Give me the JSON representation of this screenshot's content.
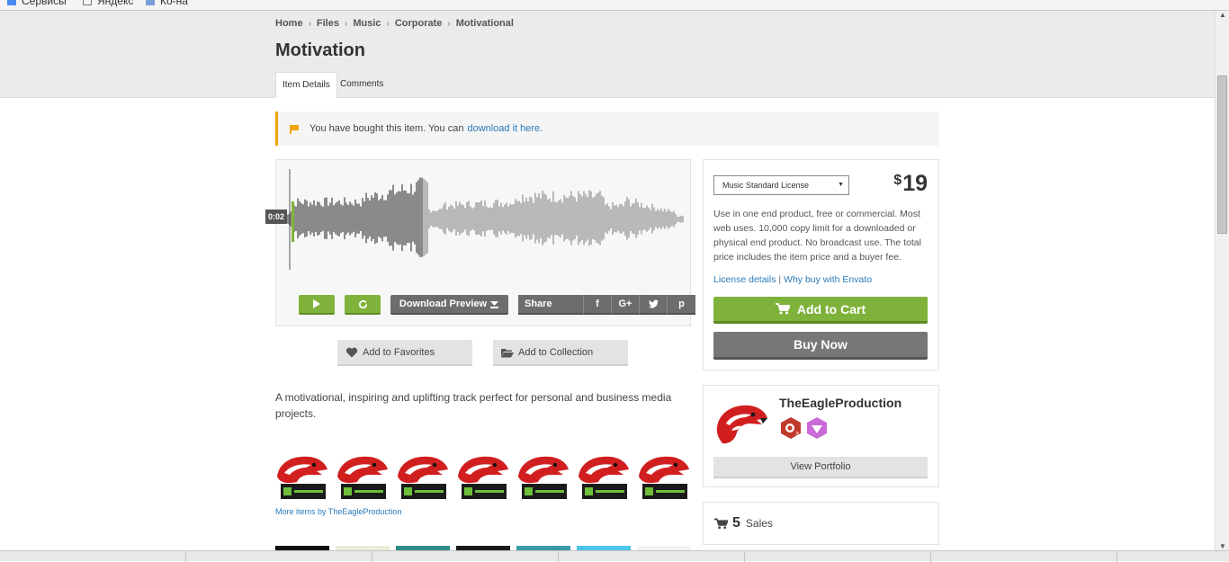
{
  "bookmarks": [
    {
      "label": "Сервисы"
    },
    {
      "label": "Яндекс"
    },
    {
      "label": "Ко-на"
    }
  ],
  "breadcrumb": [
    "Home",
    "Files",
    "Music",
    "Corporate",
    "Motivational"
  ],
  "page_title": "Motivation",
  "tabs": [
    {
      "label": "Item Details",
      "active": true
    },
    {
      "label": "Comments",
      "active": false
    }
  ],
  "notice": {
    "text": "You have bought this item. You can",
    "link": "download it here."
  },
  "player": {
    "time": "0:02",
    "progress": 0.35,
    "download_label": "Download Preview",
    "share_label": "Share",
    "share_icons": [
      "f",
      "G+",
      "t",
      "p"
    ]
  },
  "actions": {
    "favorites": "Add to Favorites",
    "collection": "Add to Collection"
  },
  "description": "A motivational, inspiring and uplifting track perfect for personal and business media projects.",
  "more_items": {
    "prefix": "More items",
    "by": "by",
    "author": "TheEagleProduction"
  },
  "purchase": {
    "license": "Music Standard License",
    "currency": "$",
    "price": "19",
    "license_description": "Use in one end product, free or commercial. Most web uses. 10,000 copy limit for a downloaded or physical end product. No broadcast use. The total price includes the item price and a buyer fee.",
    "license_details": "License details",
    "separator": "|",
    "why_buy": "Why buy with Envato",
    "add_to_cart": "Add to Cart",
    "buy_now": "Buy Now"
  },
  "author": {
    "name": "TheEagleProduction",
    "badge_level": "3",
    "view_portfolio": "View Portfolio"
  },
  "sales": {
    "count": "5",
    "label": "Sales"
  },
  "colors": {
    "accent_green": "#7fb23b",
    "link_blue": "#2a7ab8",
    "notice_orange": "#f0a30a",
    "button_gray": "#6d6d6d"
  }
}
